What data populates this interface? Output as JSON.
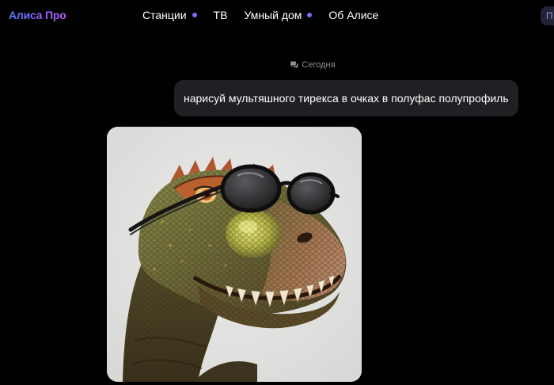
{
  "header": {
    "logo": "Алиса Про",
    "nav": [
      {
        "label": "Станции",
        "dot": true
      },
      {
        "label": "ТВ",
        "dot": false
      },
      {
        "label": "Умный дом",
        "dot": true
      },
      {
        "label": "Об Алисе",
        "dot": false
      }
    ],
    "right_button": "П"
  },
  "chat": {
    "date_label": "Сегодня",
    "user_message": "нарисуй мультяшного тирекса в очках в полуфас полупрофиль",
    "image_subject": "cartoon t-rex wearing sunglasses"
  },
  "colors": {
    "background": "#000000",
    "bubble": "#202024",
    "accent_dot": "#7f6bff",
    "muted_text": "#8c8c96"
  }
}
